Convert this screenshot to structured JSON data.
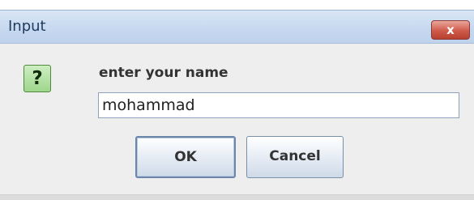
{
  "window": {
    "title": "Input",
    "close_symbol": "x"
  },
  "dialog": {
    "icon": {
      "name": "question-icon",
      "glyph": "?"
    },
    "prompt": "enter your name",
    "input_value": "mohammad"
  },
  "buttons": {
    "ok_label": "OK",
    "cancel_label": "Cancel"
  },
  "colors": {
    "titlebar": "#c6d8ef",
    "close_button": "#cf5a4a",
    "icon_background": "#9fd68c",
    "dialog_background": "#eeeeee"
  }
}
